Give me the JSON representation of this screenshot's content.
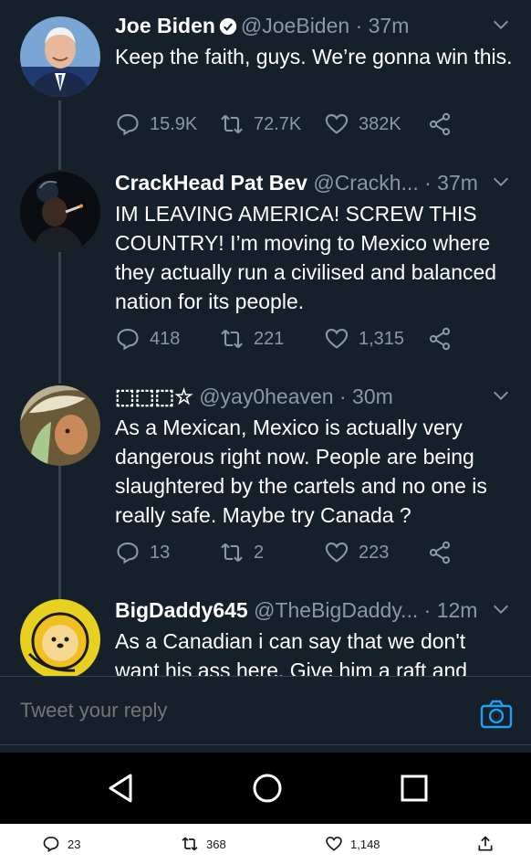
{
  "tweets": [
    {
      "name": "Joe Biden",
      "verified": true,
      "handle": "@JoeBiden",
      "time": "· 37m",
      "text": "Keep the faith, guys. We’re gonna win this.",
      "replies": "15.9K",
      "retweets": "72.7K",
      "likes": "382K"
    },
    {
      "name": "CrackHead Pat Bev",
      "verified": false,
      "handle": "@Crackh...",
      "time": "· 37m",
      "text": "IM LEAVING AMERICA! SCREW THIS COUNTRY! I’m moving to Mexico where they actually run a civilised and balanced nation for its people.",
      "replies": "418",
      "retweets": "221",
      "likes": "1,315"
    },
    {
      "name": "⬚⬚⬚☆",
      "verified": false,
      "handle": "@yay0heaven",
      "time": "· 30m",
      "text": "As a Mexican, Mexico is actually very dangerous right now. People are being slaughtered by the cartels and no one is really safe. Maybe try Canada ?",
      "replies": "13",
      "retweets": "2",
      "likes": "223"
    },
    {
      "name": "BigDaddy645",
      "verified": false,
      "handle": "@TheBigDaddy...",
      "time": "· 12m",
      "text": "As a Canadian i can say that we don't want his ass here. Give him a raft and",
      "replies": "",
      "retweets": "",
      "likes": ""
    }
  ],
  "reply_bar": {
    "placeholder": "Tweet your reply"
  },
  "nav": {
    "back": "back-icon",
    "home": "home-icon",
    "recents": "recents-icon"
  },
  "bottom_strip": {
    "replies": "23",
    "retweets": "368",
    "likes": "1,148"
  },
  "colors": {
    "background": "#15202b",
    "secondary_text": "#8899a6",
    "accent": "#1da1f2",
    "divider": "#38444d"
  }
}
